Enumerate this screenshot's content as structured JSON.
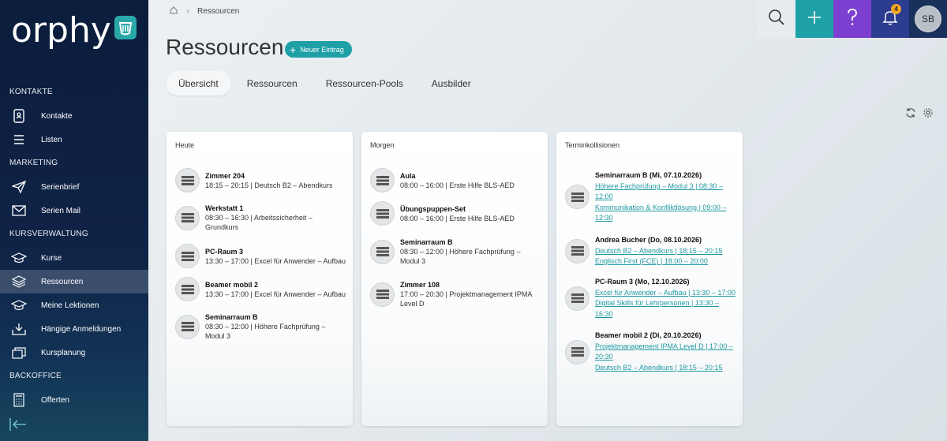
{
  "app": {
    "logo_text": "orphy"
  },
  "sidebar": {
    "sections": [
      {
        "label": "KONTAKTE"
      },
      {
        "label": "MARKETING"
      },
      {
        "label": "KURSVERWALTUNG"
      },
      {
        "label": "BACKOFFICE"
      }
    ],
    "items": [
      {
        "label": "Kontakte",
        "icon": "contacts-book-icon"
      },
      {
        "label": "Listen",
        "icon": "list-icon"
      },
      {
        "label": "Serienbrief",
        "icon": "paper-plane-icon"
      },
      {
        "label": "Serien Mail",
        "icon": "mail-icon"
      },
      {
        "label": "Kurse",
        "icon": "graduation-cap-icon"
      },
      {
        "label": "Ressourcen",
        "icon": "layers-icon",
        "active": true
      },
      {
        "label": "Meine Lektionen",
        "icon": "graduation-cap-icon"
      },
      {
        "label": "Hängige Anmeldungen",
        "icon": "inbox-download-icon"
      },
      {
        "label": "Kursplanung",
        "icon": "stacked-cards-icon"
      },
      {
        "label": "Offerten",
        "icon": "calculator-icon"
      }
    ]
  },
  "breadcrumb": {
    "current": "Ressourcen"
  },
  "topbar": {
    "avatar_initials": "SB",
    "notification_count": "4"
  },
  "page": {
    "title": "Ressourcen",
    "new_button": "Neuer Eintrag",
    "tabs": [
      "Übersicht",
      "Ressourcen",
      "Ressourcen-Pools",
      "Ausbilder"
    ]
  },
  "cards": {
    "today": {
      "title": "Heute",
      "entries": [
        {
          "name": "Zimmer 204",
          "detail": "18:15 – 20:15 | Deutsch B2 – Abendkurs"
        },
        {
          "name": "Werkstatt 1",
          "detail": "08:30 – 16:30 | Arbeitssicherheit – Grundkurs"
        },
        {
          "name": "PC-Raum 3",
          "detail": "13:30 – 17:00 | Excel für Anwender – Aufbau"
        },
        {
          "name": "Beamer mobil 2",
          "detail": "13:30 – 17:00 | Excel für Anwender – Aufbau"
        },
        {
          "name": "Seminarraum B",
          "detail": "08:30 – 12:00 | Höhere Fachprüfung – Modul 3"
        }
      ]
    },
    "tomorrow": {
      "title": "Morgen",
      "entries": [
        {
          "name": "Aula",
          "detail": "08:00 – 16:00 | Erste Hilfe BLS-AED"
        },
        {
          "name": "Übungspuppen-Set",
          "detail": "08:00 – 16:00 | Erste Hilfe BLS-AED"
        },
        {
          "name": "Seminarraum B",
          "detail": "08:30 – 12:00 | Höhere Fachprüfung – Modul 3"
        },
        {
          "name": "Zimmer 108",
          "detail": "17:00 – 20:30 | Projektmanagement IPMA Level D"
        }
      ]
    },
    "collisions": {
      "title": "Terminkollisionen",
      "entries": [
        {
          "name": "Seminarraum B (Mi, 07.10.2026)",
          "links": [
            "Höhere Fachprüfung – Modul 3 | 08:30 – 12:00",
            "Kommunikation & Konfliktlösung | 09:00 – 12:30"
          ]
        },
        {
          "name": "Andrea Bucher (Do, 08.10.2026)",
          "links": [
            "Deutsch B2 – Abendkurs | 18:15 – 20:15",
            "Englisch First (FCE) | 18:00 – 20:00"
          ]
        },
        {
          "name": "PC-Raum 3 (Mo, 12.10.2026)",
          "links": [
            "Excel für Anwender – Aufbau | 13:30 – 17:00",
            "Digital Skills für Lehrpersonen | 13:30 – 16:30"
          ]
        },
        {
          "name": "Beamer mobil 2 (Di, 20.10.2026)",
          "links": [
            "Projektmanagement IPMA Level D | 17:00 – 20:30",
            "Deutsch B2 – Abendkurs | 18:15 – 20:15"
          ]
        }
      ]
    }
  },
  "colors": {
    "teal": "#1fa0a7",
    "purple": "#7c3fd0",
    "navy": "#2c3c8f",
    "badge": "#f2a623"
  }
}
